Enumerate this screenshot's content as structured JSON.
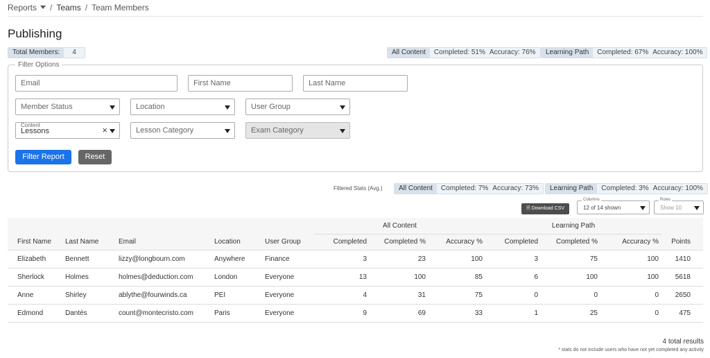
{
  "breadcrumb": {
    "reports": "Reports",
    "teams": "Teams",
    "current": "Team Members",
    "sep": "/"
  },
  "page_title": "Publishing",
  "summary": {
    "total_members_label": "Total Members:",
    "total_members_value": "4",
    "all_content": {
      "label": "All Content",
      "completed": "Completed: 51%",
      "accuracy": "Accuracy: 76%"
    },
    "learning_path": {
      "label": "Learning Path",
      "completed": "Completed: 67%",
      "accuracy": "Accuracy: 100%"
    }
  },
  "filters": {
    "legend": "Filter Options",
    "email_placeholder": "Email",
    "first_name_placeholder": "First Name",
    "last_name_placeholder": "Last Name",
    "member_status": "Member Status",
    "location": "Location",
    "user_group": "User Group",
    "content_label": "Content",
    "content_value": "Lessons",
    "lesson_category": "Lesson Category",
    "exam_category": "Exam Category",
    "filter_button": "Filter Report",
    "reset_button": "Reset"
  },
  "filtered_stats": {
    "label": "Filtered Stats (Avg.)",
    "all_content": {
      "label": "All Content",
      "completed": "Completed: 7%",
      "accuracy": "Accuracy: 73%"
    },
    "learning_path": {
      "label": "Learning Path",
      "completed": "Completed: 3%",
      "accuracy": "Accuracy: 100%"
    }
  },
  "toolbar": {
    "download_csv": "Download CSV",
    "columns_label": "Columns",
    "columns_value": "12 of 14 shown",
    "rows_label": "Rows",
    "rows_value": "Show 10"
  },
  "table": {
    "group_all_content": "All Content",
    "group_learning_path": "Learning Path",
    "headers": [
      "First Name",
      "Last Name",
      "Email",
      "Location",
      "User Group",
      "Completed",
      "Completed %",
      "Accuracy %",
      "Completed",
      "Completed %",
      "Accuracy %",
      "Points"
    ],
    "rows": [
      [
        "Elizabeth",
        "Bennett",
        "lizzy@longbourn.com",
        "Anywhere",
        "Finance",
        "3",
        "23",
        "100",
        "3",
        "75",
        "100",
        "1410"
      ],
      [
        "Sherlock",
        "Holmes",
        "holmes@deduction.com",
        "London",
        "Everyone",
        "13",
        "100",
        "85",
        "6",
        "100",
        "100",
        "5618"
      ],
      [
        "Anne",
        "Shirley",
        "ablythe@fourwinds.ca",
        "PEI",
        "Everyone",
        "4",
        "31",
        "75",
        "0",
        "0",
        "0",
        "2650"
      ],
      [
        "Edmond",
        "Dantès",
        "count@montecristo.com",
        "Paris",
        "Everyone",
        "9",
        "69",
        "33",
        "1",
        "25",
        "0",
        "475"
      ]
    ]
  },
  "footer": {
    "total_results": "4 total results",
    "note": "* stats do not include users who have not yet completed any activity"
  },
  "colors": {
    "primary": "#1a73e8",
    "secondary": "#666666",
    "pill_key": "#d9e2eb",
    "pill_bg": "#eef3f8"
  }
}
